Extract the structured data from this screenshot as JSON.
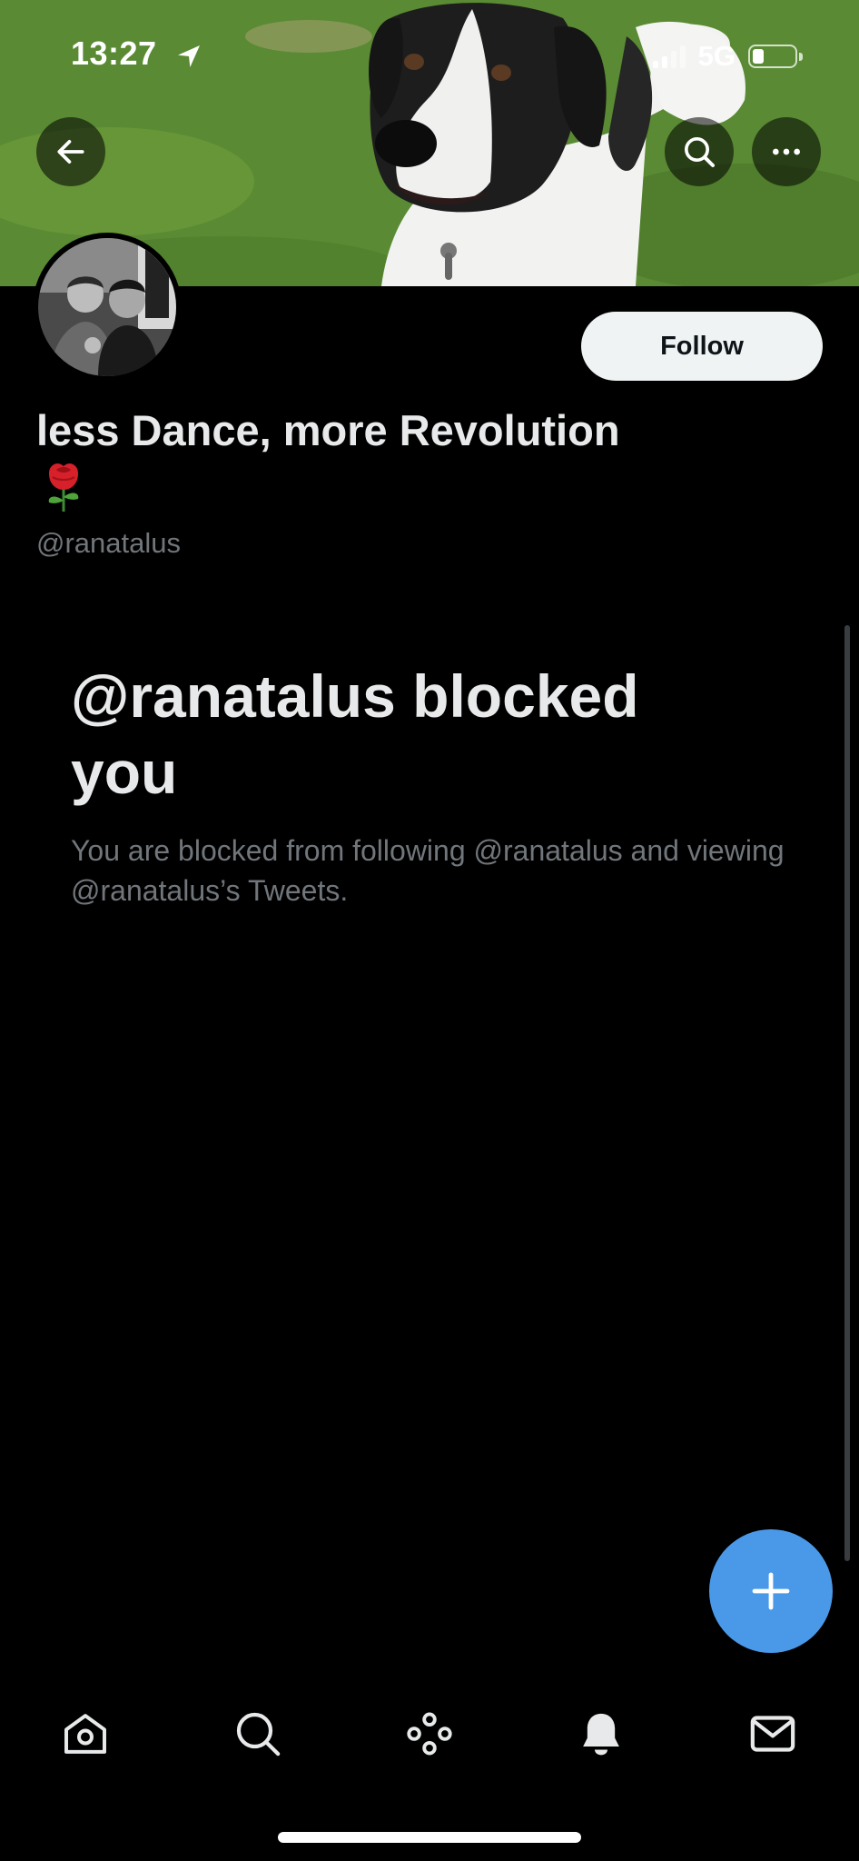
{
  "status_bar": {
    "time": "13:27",
    "network": "5G"
  },
  "header": {
    "back_icon": "arrow-left-icon",
    "search_icon": "search-icon",
    "more_icon": "more-horizontal-icon"
  },
  "profile": {
    "display_name": "less Dance, more Revolution",
    "name_emoji": "rose-emoji",
    "handle": "@ranatalus",
    "follow_label": "Follow"
  },
  "blocked_notice": {
    "title": "@ranatalus blocked you",
    "description": "You are blocked from following @ranatalus and viewing @ranatalus’s Tweets."
  },
  "fab": {
    "icon": "plus-icon",
    "color": "#4a99e9"
  },
  "bottom_nav": {
    "items": [
      {
        "icon": "home-icon"
      },
      {
        "icon": "search-icon"
      },
      {
        "icon": "spaces-icon"
      },
      {
        "icon": "notifications-bell-icon"
      },
      {
        "icon": "messages-envelope-icon"
      }
    ]
  },
  "colors": {
    "background": "#000000",
    "primary_text": "#e7e9ea",
    "secondary_text": "#71767b",
    "follow_button_bg": "#eff3f4",
    "accent": "#4a99e9"
  }
}
